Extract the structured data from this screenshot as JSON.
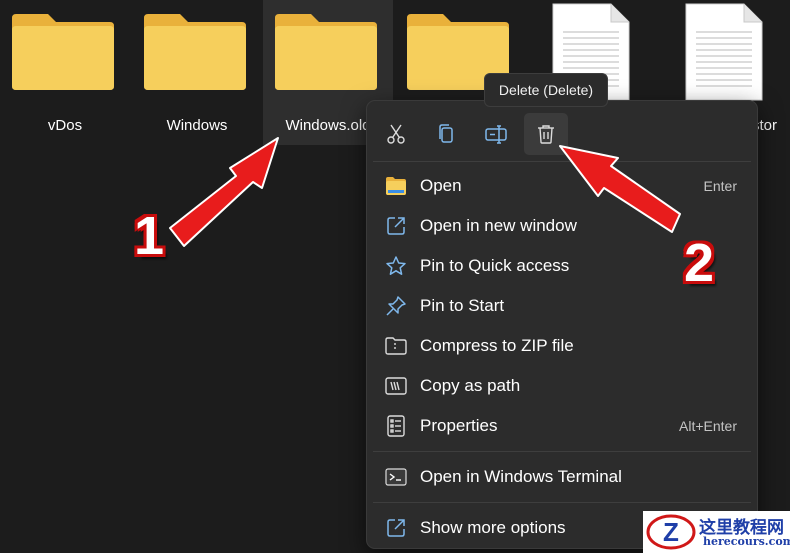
{
  "files": [
    {
      "label": "vDos",
      "type": "folder"
    },
    {
      "label": "Windows",
      "type": "folder"
    },
    {
      "label": "Windows.old",
      "type": "folder",
      "selected": true
    },
    {
      "label": "",
      "type": "folder"
    },
    {
      "label": "",
      "type": "document"
    },
    {
      "label": "stor",
      "type": "document"
    }
  ],
  "tooltip": "Delete (Delete)",
  "toolbar": {
    "cut_icon": "scissors-icon",
    "copy_icon": "copy-icon",
    "rename_icon": "rename-icon",
    "delete_icon": "trash-icon"
  },
  "menu": {
    "items": [
      {
        "label": "Open",
        "shortcut": "Enter",
        "icon": "folder-icon"
      },
      {
        "label": "Open in new window",
        "shortcut": "",
        "icon": "open-new-window-icon"
      },
      {
        "label": "Pin to Quick access",
        "shortcut": "",
        "icon": "star-icon"
      },
      {
        "label": "Pin to Start",
        "shortcut": "",
        "icon": "pin-icon"
      },
      {
        "label": "Compress to ZIP file",
        "shortcut": "",
        "icon": "zip-icon"
      },
      {
        "label": "Copy as path",
        "shortcut": "",
        "icon": "copy-path-icon"
      },
      {
        "label": "Properties",
        "shortcut": "Alt+Enter",
        "icon": "properties-icon"
      },
      {
        "label": "Open in Windows Terminal",
        "shortcut": "",
        "icon": "terminal-icon"
      },
      {
        "label": "Show more options",
        "shortcut": "",
        "icon": "show-more-icon"
      }
    ]
  },
  "annotations": {
    "one": "1",
    "two": "2"
  },
  "watermark": {
    "chinese": "这里教程网",
    "url": "herecours.com",
    "logo_letter": "Z"
  },
  "colors": {
    "folder": "#f6c94d",
    "accent": "#7fb8ec",
    "arrow": "#e81c1c"
  }
}
